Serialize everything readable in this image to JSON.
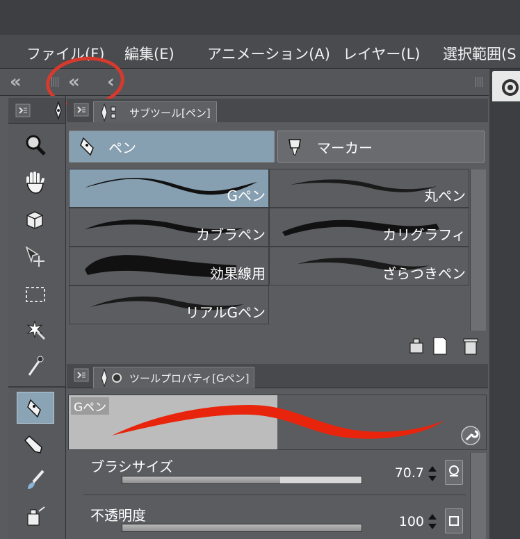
{
  "menu": {
    "items": [
      "ファイル(F)",
      "編集(E)",
      "アニメーション(A)",
      "レイヤー(L)",
      "選択範囲(S"
    ]
  },
  "subtool_panel": {
    "tab_label": "サブツール[ペン]",
    "groups": [
      "ペン",
      "マーカー"
    ],
    "brushes": [
      "Gペン",
      "丸ペン",
      "カブラペン",
      "カリグラフィ",
      "効果線用",
      "ざらつきペン",
      "リアルGペン"
    ]
  },
  "tool_property": {
    "tab_label": "ツールプロパティ[Gペン]",
    "preview_label": "Gペン",
    "brush_size_label": "ブラシサイズ",
    "brush_size_value": "70.7",
    "brush_size_fraction": 0.66,
    "opacity_label": "不透明度",
    "opacity_value": "100",
    "opacity_fraction": 1.0
  },
  "colors": {
    "accent_selected": "#869fb1",
    "stroke_preview": "#e8250c",
    "annotation_circle": "#d73a2c"
  },
  "icons": [
    "search-icon",
    "hand-icon",
    "rotate-view-icon",
    "move-icon",
    "selection-icon",
    "magic-wand-icon",
    "eyedropper-icon",
    "pen-icon",
    "pencil-icon",
    "brush-icon",
    "airbrush-icon"
  ]
}
